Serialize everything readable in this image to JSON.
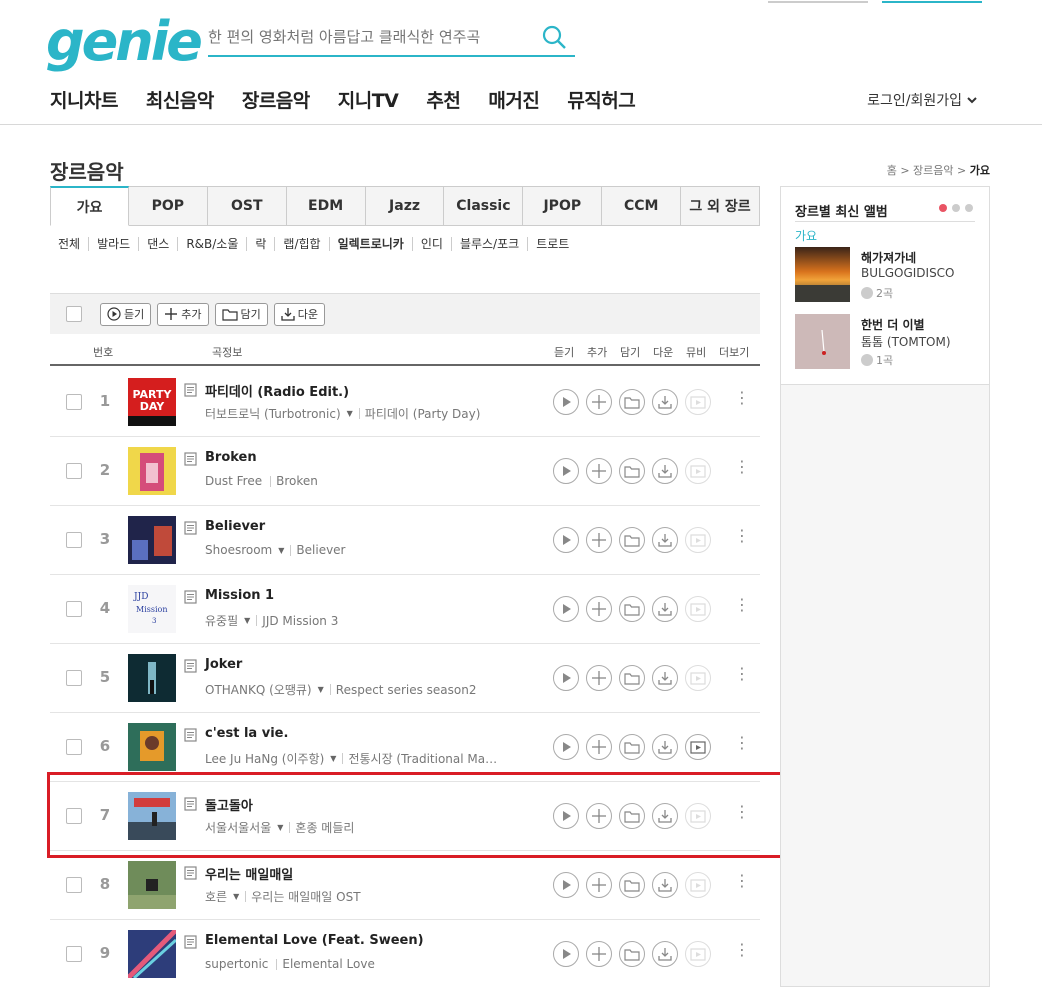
{
  "header": {
    "logo": "genie",
    "search_placeholder": "한 편의 영화처럼 아름답고 클래식한 연주곡",
    "nav": [
      "지니차트",
      "최신음악",
      "장르음악",
      "지니TV",
      "추천",
      "매거진",
      "뮤직허그"
    ],
    "login": "로그인/회원가입"
  },
  "page": {
    "title": "장르음악",
    "breadcrumb": [
      "홈",
      "장르음악",
      "가요"
    ]
  },
  "tabs": [
    "가요",
    "POP",
    "OST",
    "EDM",
    "Jazz",
    "Classic",
    "JPOP",
    "CCM",
    "그 외 장르"
  ],
  "active_tab": "가요",
  "subgenres": [
    "전체",
    "발라드",
    "댄스",
    "R&B/소울",
    "락",
    "랩/힙합",
    "일렉트로니카",
    "인디",
    "블루스/포크",
    "트로트"
  ],
  "toolbar": {
    "play": "듣기",
    "add": "추가",
    "save": "담기",
    "download": "다운"
  },
  "table_header": {
    "num": "번호",
    "info": "곡정보",
    "listen": "듣기",
    "add": "추가",
    "save": "담기",
    "down": "다운",
    "mv": "뮤비",
    "more": "더보기"
  },
  "songs": [
    {
      "num": "1",
      "title": "파티데이 (Radio Edit.)",
      "artist": "터보트로닉 (Turbotronic)",
      "album": "파티데이 (Party Day)"
    },
    {
      "num": "2",
      "title": "Broken",
      "artist": "Dust Free",
      "album": "Broken"
    },
    {
      "num": "3",
      "title": "Believer",
      "artist": "Shoesroom",
      "album": "Believer"
    },
    {
      "num": "4",
      "title": "Mission 1",
      "artist": "유중필",
      "album": "JJD Mission 3"
    },
    {
      "num": "5",
      "title": "Joker",
      "artist": "OTHANKQ (오땡큐)",
      "album": "Respect series season2"
    },
    {
      "num": "6",
      "title": "c'est la vie.",
      "artist": "Lee Ju HaNg (이주항)",
      "album": "전통시장 (Traditional Ma…"
    },
    {
      "num": "7",
      "title": "돌고돌아",
      "artist": "서울서울서울",
      "album": "혼종 메들리"
    },
    {
      "num": "8",
      "title": "우리는 매일매일",
      "artist": "호른",
      "album": "우리는 매일매일 OST"
    },
    {
      "num": "9",
      "title": "Elemental Love (Feat. Sween)",
      "artist": "supertonic",
      "album": "Elemental Love"
    }
  ],
  "sidebar": {
    "title": "장르별 최신 앨범",
    "genre": "가요",
    "albums": [
      {
        "title": "해가져가네",
        "artist": "BULGOGIDISCO",
        "count": "2곡"
      },
      {
        "title": "한번 더 이별",
        "artist": "톰톰 (TOMTOM)",
        "count": "1곡"
      }
    ]
  },
  "colors": {
    "accent": "#2bb5c8",
    "highlight": "#d91d26",
    "dot_active": "#e95464"
  }
}
